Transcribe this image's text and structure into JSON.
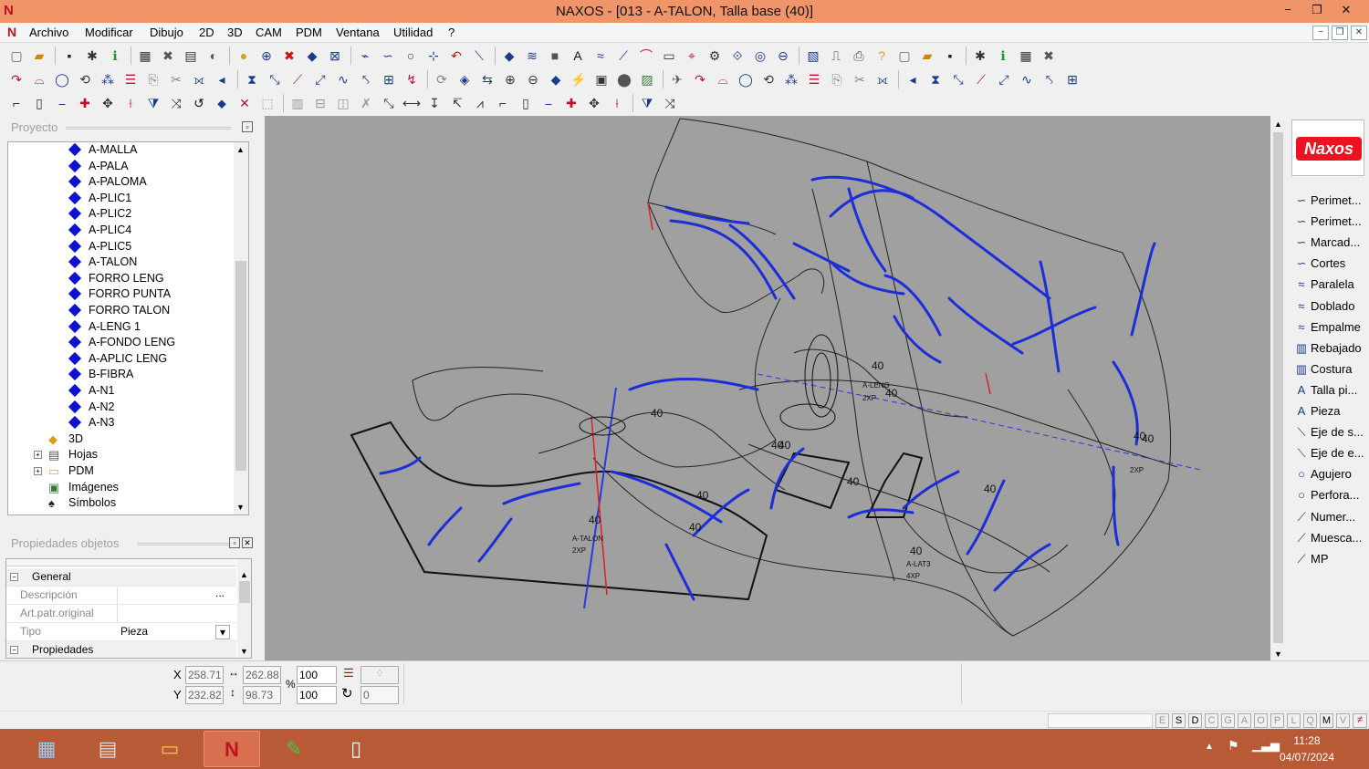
{
  "window": {
    "title": "NAXOS - [013 - A-TALON, Talla base (40)]",
    "app_icon": "naxos-logo",
    "minimize": "−",
    "maximize": "❐",
    "close": "✕"
  },
  "menu": [
    "Archivo",
    "Modificar",
    "Dibujo",
    "2D",
    "3D",
    "CAM",
    "PDM",
    "Ventana",
    "Utilidad",
    "?"
  ],
  "mdi_controls": [
    "−",
    "❐",
    "✕"
  ],
  "project_panel": {
    "title": "Proyecto",
    "pieces": [
      "A-MALLA",
      "A-PALA",
      "A-PALOMA",
      "A-PLIC1",
      "A-PLIC2",
      "A-PLIC4",
      "A-PLIC5",
      "A-TALON",
      "FORRO LENG",
      "FORRO PUNTA",
      "FORRO TALON",
      "A-LENG 1",
      "A-FONDO LENG",
      "A-APLIC LENG",
      "B-FIBRA",
      "A-N1",
      "A-N2",
      "A-N3"
    ],
    "folders": [
      "3D",
      "Hojas",
      "PDM",
      "Imágenes",
      "Símbolos"
    ]
  },
  "props_panel": {
    "title": "Propiedades objetos",
    "group_general": "General",
    "rows": [
      {
        "label": "Descripción",
        "value": "",
        "button": "..."
      },
      {
        "label": "Art.patr.original",
        "value": ""
      },
      {
        "label": "Tipo",
        "value": "Pieza",
        "dropdown": "▾"
      }
    ],
    "group_props": "Propiedades"
  },
  "canvas": {
    "labels": [
      {
        "t": "40"
      },
      {
        "t": "A-TALON"
      },
      {
        "t": "2XP"
      },
      {
        "t": "40"
      },
      {
        "t": "40"
      },
      {
        "t": "40"
      },
      {
        "t": "A-LENG"
      },
      {
        "t": "2XP"
      },
      {
        "t": "40"
      },
      {
        "t": "40"
      },
      {
        "t": "40"
      },
      {
        "t": "A-LAT3"
      },
      {
        "t": "4XP"
      },
      {
        "t": "40"
      },
      {
        "t": "40"
      },
      {
        "t": "40"
      },
      {
        "t": "2XP"
      },
      {
        "t": "40"
      },
      {
        "t": "40"
      },
      {
        "t": "40"
      }
    ]
  },
  "right_tools": [
    "Perimet...",
    "Perimet...",
    "Marcad...",
    "Cortes",
    "Paralela",
    "Doblado",
    "Empalme",
    "Rebajado",
    "Costura",
    "Talla pi...",
    "Pieza",
    "Eje de s...",
    "Eje de e...",
    "Agujero",
    "Perfora...",
    "Numer...",
    "Muesca...",
    "MP"
  ],
  "right_tool_icons": [
    "curve-icon",
    "curve-icon",
    "curve-icon",
    "curve-icon",
    "parallel-icon",
    "fold-icon",
    "fillet-icon",
    "trim-icon",
    "seam-icon",
    "text-icon",
    "text-icon",
    "axis-icon",
    "axis-icon",
    "hole-icon",
    "hole-icon",
    "number-icon",
    "notch-icon",
    "mp-icon"
  ],
  "brand": "Naxos",
  "coords": {
    "x_label": "X",
    "y_label": "Y",
    "x": "258.71",
    "y": "232.82",
    "w": "262.88",
    "h": "98.73",
    "pct_label": "%",
    "sx": "100",
    "sy": "100",
    "rot": "0"
  },
  "status_flags": [
    "E",
    "S",
    "D",
    "C",
    "G",
    "A",
    "O",
    "P",
    "L",
    "Q",
    "M",
    "V"
  ],
  "clock": {
    "time": "11:28",
    "date": "04/07/2024"
  },
  "colors": {
    "accent_title": "#f0956a",
    "taskbar": "#b75a35",
    "blue_line": "#1d2ed8",
    "red_line": "#e02020"
  }
}
